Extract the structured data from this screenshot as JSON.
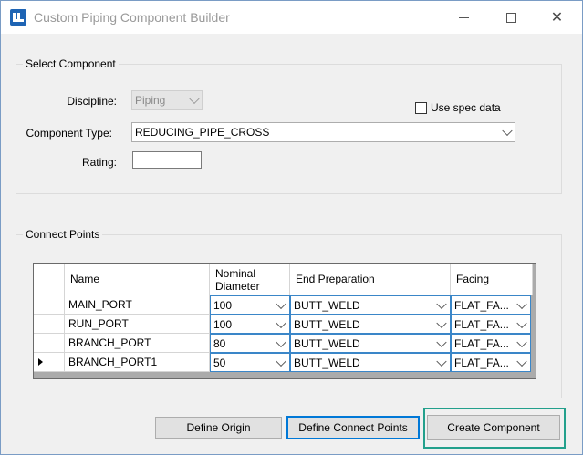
{
  "window": {
    "title": "Custom Piping Component Builder"
  },
  "select_component": {
    "group_label": "Select Component",
    "discipline_label": "Discipline:",
    "discipline_value": "Piping",
    "use_spec_label": "Use spec data",
    "component_type_label": "Component Type:",
    "component_type_value": "REDUCING_PIPE_CROSS",
    "rating_label": "Rating:",
    "rating_value": ""
  },
  "connect_points": {
    "group_label": "Connect Points",
    "headers": {
      "name": "Name",
      "nominal_diameter": "Nominal Diameter",
      "end_preparation": "End Preparation",
      "facing": "Facing"
    },
    "rows": [
      {
        "name": "MAIN_PORT",
        "nominal_diameter": "100",
        "end_preparation": "BUTT_WELD",
        "facing": "FLAT_FA..."
      },
      {
        "name": "RUN_PORT",
        "nominal_diameter": "100",
        "end_preparation": "BUTT_WELD",
        "facing": "FLAT_FA..."
      },
      {
        "name": "BRANCH_PORT",
        "nominal_diameter": "80",
        "end_preparation": "BUTT_WELD",
        "facing": "FLAT_FA..."
      },
      {
        "name": "BRANCH_PORT1",
        "nominal_diameter": "50",
        "end_preparation": "BUTT_WELD",
        "facing": "FLAT_FA..."
      }
    ]
  },
  "buttons": {
    "define_origin": "Define Origin",
    "define_connect_points": "Define Connect Points",
    "create_component": "Create Component"
  },
  "colors": {
    "accent": "#0078d7",
    "highlight": "#23a08c",
    "app_icon": "#1e64b4"
  }
}
